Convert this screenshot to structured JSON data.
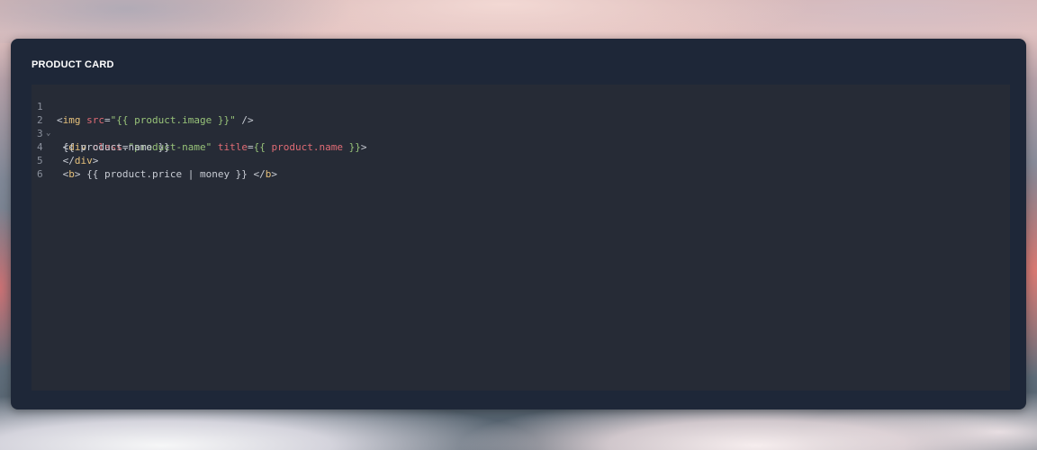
{
  "panel": {
    "title": "PRODUCT CARD"
  },
  "editor": {
    "line_numbers": [
      "1",
      "2",
      "3",
      "4",
      "5",
      "6"
    ],
    "fold_marker": "⌄",
    "lines": [
      {
        "tokens": [
          {
            "t": "<",
            "k": "punct"
          },
          {
            "t": "img",
            "k": "tag"
          },
          {
            "t": " ",
            "k": "plain"
          },
          {
            "t": "src",
            "k": "attr"
          },
          {
            "t": "=",
            "k": "punct"
          },
          {
            "t": "\"{{ product.image }}\"",
            "k": "str"
          },
          {
            "t": " />",
            "k": "punct"
          }
        ]
      },
      {
        "tokens": [
          {
            "t": " <",
            "k": "punct"
          },
          {
            "t": "div",
            "k": "tag"
          },
          {
            "t": " ",
            "k": "plain"
          },
          {
            "t": "class",
            "k": "attr"
          },
          {
            "t": "=",
            "k": "punct"
          },
          {
            "t": "\"product-name\"",
            "k": "str"
          },
          {
            "t": " ",
            "k": "plain"
          },
          {
            "t": "title",
            "k": "attr"
          },
          {
            "t": "=",
            "k": "punct"
          },
          {
            "t": "{{ ",
            "k": "str"
          },
          {
            "t": "product.name",
            "k": "attr"
          },
          {
            "t": " }}",
            "k": "str"
          },
          {
            "t": ">",
            "k": "punct"
          }
        ]
      },
      {
        "tokens": [
          {
            "t": " {{ product.name }}",
            "k": "plain"
          }
        ]
      },
      {
        "tokens": [
          {
            "t": " </",
            "k": "punct"
          },
          {
            "t": "div",
            "k": "tag"
          },
          {
            "t": ">",
            "k": "punct"
          }
        ]
      },
      {
        "tokens": [
          {
            "t": " <",
            "k": "punct"
          },
          {
            "t": "b",
            "k": "tag"
          },
          {
            "t": "> {{ product.price | money }} </",
            "k": "punct"
          },
          {
            "t": "b",
            "k": "tag"
          },
          {
            "t": ">",
            "k": "punct"
          }
        ]
      },
      {
        "tokens": []
      }
    ]
  },
  "colors": {
    "card_bg": "#1e2738",
    "editor_bg": "#262b36",
    "tag": "#e5c07b",
    "attribute": "#e06c75",
    "string": "#98c379",
    "text": "#c8ccd4",
    "line_number": "#8a909c"
  }
}
